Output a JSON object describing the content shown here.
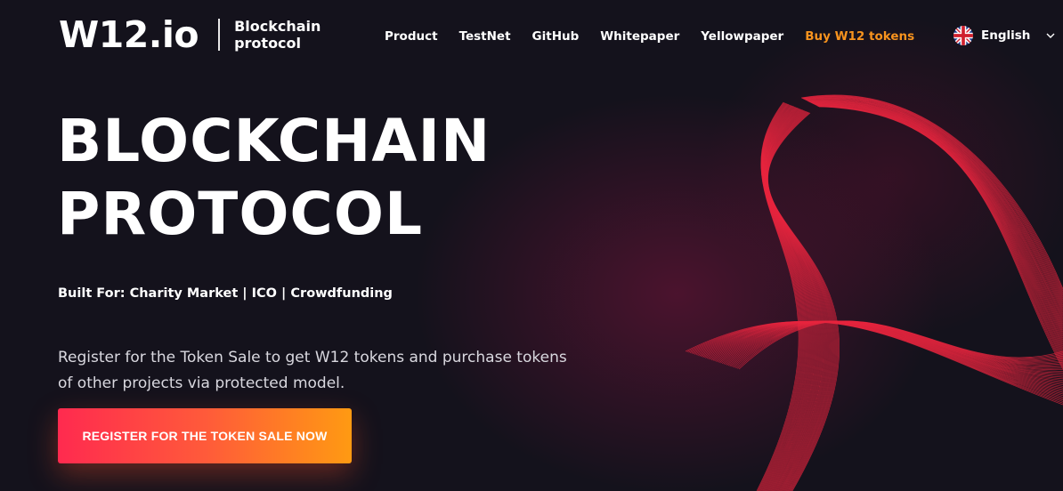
{
  "brand": {
    "logo": "W12.io",
    "tagline_line1": "Blockchain",
    "tagline_line2": "protocol"
  },
  "nav": {
    "items": [
      {
        "label": "Product"
      },
      {
        "label": "TestNet"
      },
      {
        "label": "GitHub"
      },
      {
        "label": "Whitepaper"
      },
      {
        "label": "Yellowpaper"
      },
      {
        "label": "Buy W12 tokens"
      }
    ]
  },
  "language": {
    "selected": "English",
    "icons": [
      "uk-flag-icon",
      "chevron-down-icon"
    ]
  },
  "hero": {
    "title_line1": "BLOCKCHAIN",
    "title_line2": "PROTOCOL",
    "built_for": "Built For: Charity Market | ICO | Crowdfunding",
    "description": "Register for the Token Sale to get W12 tokens and purchase tokens of other projects via protected model.",
    "cta_label": "REGISTER FOR THE TOKEN SALE NOW"
  },
  "colors": {
    "background": "#14121c",
    "accent_orange": "#f7931e",
    "wave_red": "#e8263f",
    "cta_start": "#ff2a4f",
    "cta_end": "#ff9a12"
  }
}
